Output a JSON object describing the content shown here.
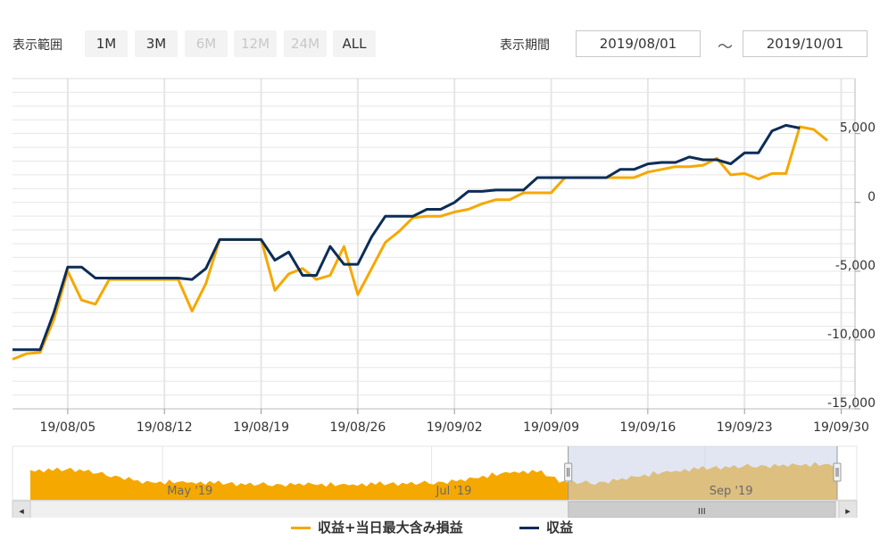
{
  "toolbar": {
    "range_label": "表示範囲",
    "range_buttons": [
      {
        "label": "1M",
        "enabled": true
      },
      {
        "label": "3M",
        "enabled": true
      },
      {
        "label": "6M",
        "enabled": false
      },
      {
        "label": "12M",
        "enabled": false
      },
      {
        "label": "24M",
        "enabled": false
      },
      {
        "label": "ALL",
        "enabled": true
      }
    ],
    "period_label": "表示期間",
    "from_date": "2019/08/01",
    "separator": "～",
    "to_date": "2019/10/01"
  },
  "colors": {
    "series_a": "#f5a800",
    "series_b": "#0c2d57",
    "navigator_fill": "#f5a800",
    "navigator_mask": "#c8d2e8",
    "grid": "#e6e6e6"
  },
  "scrollbar": {
    "left_arrow": "◂",
    "right_arrow": "▸",
    "thumb_grip": "III"
  },
  "chart_data": {
    "type": "line",
    "title": "",
    "xlabel": "",
    "ylabel": "",
    "x_range": [
      "2019/08/01",
      "2019/10/01"
    ],
    "ylim": [
      -15000,
      9000
    ],
    "grid": true,
    "legend_position": "bottom-center",
    "x_ticks": [
      "19/08/05",
      "19/08/12",
      "19/08/19",
      "19/08/26",
      "19/09/02",
      "19/09/09",
      "19/09/16",
      "19/09/23",
      "19/09/30"
    ],
    "y_ticks": [
      {
        "value": 5000,
        "label": "5,000"
      },
      {
        "value": 0,
        "label": "0"
      },
      {
        "value": -5000,
        "label": "-5,000"
      },
      {
        "value": -10000,
        "label": "-10,000"
      },
      {
        "value": -15000,
        "label": "-15,000"
      }
    ],
    "series": [
      {
        "name": "収益+当日最大含み損益",
        "color": "#f5a800",
        "points": [
          [
            "2019/08/01",
            -11400
          ],
          [
            "2019/08/02",
            -11000
          ],
          [
            "2019/08/03",
            -10900
          ],
          [
            "2019/08/04",
            -8500
          ],
          [
            "2019/08/05",
            -5000
          ],
          [
            "2019/08/06",
            -7100
          ],
          [
            "2019/08/07",
            -7400
          ],
          [
            "2019/08/08",
            -5600
          ],
          [
            "2019/08/09",
            -5600
          ],
          [
            "2019/08/10",
            -5600
          ],
          [
            "2019/08/11",
            -5600
          ],
          [
            "2019/08/12",
            -5600
          ],
          [
            "2019/08/13",
            -5600
          ],
          [
            "2019/08/14",
            -7900
          ],
          [
            "2019/08/15",
            -5900
          ],
          [
            "2019/08/16",
            -2700
          ],
          [
            "2019/08/17",
            -2700
          ],
          [
            "2019/08/18",
            -2700
          ],
          [
            "2019/08/19",
            -2700
          ],
          [
            "2019/08/20",
            -6400
          ],
          [
            "2019/08/21",
            -5200
          ],
          [
            "2019/08/22",
            -4800
          ],
          [
            "2019/08/23",
            -5600
          ],
          [
            "2019/08/24",
            -5300
          ],
          [
            "2019/08/25",
            -3200
          ],
          [
            "2019/08/26",
            -6700
          ],
          [
            "2019/08/27",
            -4800
          ],
          [
            "2019/08/28",
            -2900
          ],
          [
            "2019/08/29",
            -2100
          ],
          [
            "2019/08/30",
            -1100
          ],
          [
            "2019/08/31",
            -1000
          ],
          [
            "2019/09/01",
            -1000
          ],
          [
            "2019/09/02",
            -700
          ],
          [
            "2019/09/03",
            -500
          ],
          [
            "2019/09/04",
            -100
          ],
          [
            "2019/09/05",
            200
          ],
          [
            "2019/09/06",
            200
          ],
          [
            "2019/09/07",
            700
          ],
          [
            "2019/09/08",
            700
          ],
          [
            "2019/09/09",
            700
          ],
          [
            "2019/09/10",
            1800
          ],
          [
            "2019/09/11",
            1800
          ],
          [
            "2019/09/12",
            1800
          ],
          [
            "2019/09/13",
            1800
          ],
          [
            "2019/09/14",
            1800
          ],
          [
            "2019/09/15",
            1800
          ],
          [
            "2019/09/16",
            2200
          ],
          [
            "2019/09/17",
            2400
          ],
          [
            "2019/09/18",
            2600
          ],
          [
            "2019/09/19",
            2600
          ],
          [
            "2019/09/20",
            2700
          ],
          [
            "2019/09/21",
            3200
          ],
          [
            "2019/09/22",
            2000
          ],
          [
            "2019/09/23",
            2100
          ],
          [
            "2019/09/24",
            1700
          ],
          [
            "2019/09/25",
            2100
          ],
          [
            "2019/09/26",
            2100
          ],
          [
            "2019/09/27",
            5500
          ],
          [
            "2019/09/28",
            5300
          ],
          [
            "2019/09/29",
            4500
          ]
        ]
      },
      {
        "name": "収益",
        "color": "#0c2d57",
        "points": [
          [
            "2019/08/01",
            -10700
          ],
          [
            "2019/08/02",
            -10700
          ],
          [
            "2019/08/03",
            -10700
          ],
          [
            "2019/08/04",
            -8000
          ],
          [
            "2019/08/05",
            -4700
          ],
          [
            "2019/08/06",
            -4700
          ],
          [
            "2019/08/07",
            -5500
          ],
          [
            "2019/08/08",
            -5500
          ],
          [
            "2019/08/09",
            -5500
          ],
          [
            "2019/08/10",
            -5500
          ],
          [
            "2019/08/11",
            -5500
          ],
          [
            "2019/08/12",
            -5500
          ],
          [
            "2019/08/13",
            -5500
          ],
          [
            "2019/08/14",
            -5600
          ],
          [
            "2019/08/15",
            -4800
          ],
          [
            "2019/08/16",
            -2700
          ],
          [
            "2019/08/17",
            -2700
          ],
          [
            "2019/08/18",
            -2700
          ],
          [
            "2019/08/19",
            -2700
          ],
          [
            "2019/08/20",
            -4200
          ],
          [
            "2019/08/21",
            -3600
          ],
          [
            "2019/08/22",
            -5300
          ],
          [
            "2019/08/23",
            -5300
          ],
          [
            "2019/08/24",
            -3200
          ],
          [
            "2019/08/25",
            -4500
          ],
          [
            "2019/08/26",
            -4500
          ],
          [
            "2019/08/27",
            -2500
          ],
          [
            "2019/08/28",
            -1000
          ],
          [
            "2019/08/29",
            -1000
          ],
          [
            "2019/08/30",
            -1000
          ],
          [
            "2019/08/31",
            -500
          ],
          [
            "2019/09/01",
            -500
          ],
          [
            "2019/09/02",
            0
          ],
          [
            "2019/09/03",
            800
          ],
          [
            "2019/09/04",
            800
          ],
          [
            "2019/09/05",
            900
          ],
          [
            "2019/09/06",
            900
          ],
          [
            "2019/09/07",
            900
          ],
          [
            "2019/09/08",
            1800
          ],
          [
            "2019/09/09",
            1800
          ],
          [
            "2019/09/10",
            1800
          ],
          [
            "2019/09/11",
            1800
          ],
          [
            "2019/09/12",
            1800
          ],
          [
            "2019/09/13",
            1800
          ],
          [
            "2019/09/14",
            2400
          ],
          [
            "2019/09/15",
            2400
          ],
          [
            "2019/09/16",
            2800
          ],
          [
            "2019/09/17",
            2900
          ],
          [
            "2019/09/18",
            2900
          ],
          [
            "2019/09/19",
            3300
          ],
          [
            "2019/09/20",
            3100
          ],
          [
            "2019/09/21",
            3100
          ],
          [
            "2019/09/22",
            2800
          ],
          [
            "2019/09/23",
            3600
          ],
          [
            "2019/09/24",
            3600
          ],
          [
            "2019/09/25",
            5200
          ],
          [
            "2019/09/26",
            5600
          ],
          [
            "2019/09/27",
            5400
          ]
        ]
      }
    ],
    "navigator": {
      "x_labels": [
        "May '19",
        "Jul '19",
        "Sep '19"
      ],
      "selected_range": [
        "2019/08/01",
        "2019/10/01"
      ]
    }
  }
}
